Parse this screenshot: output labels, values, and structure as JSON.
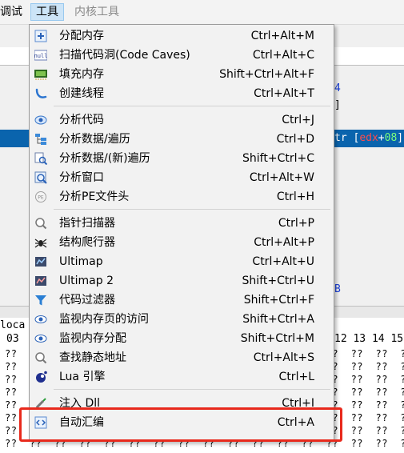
{
  "menubar": {
    "debug_label": "调试",
    "tools_label": "工具",
    "kernel_label": "内核工具"
  },
  "background": {
    "disasm_frag_top": "4",
    "disasm_frag_bracket": "]",
    "sel_text_prefix": "tr [",
    "sel_text_reg": "edx",
    "sel_text_plus": "+",
    "sel_text_offset": "08",
    "sel_text_close": "]",
    "disasm_frag_bottom": "B",
    "hex_header_prefix": "loca",
    "hex_header_left": "03",
    "hex_header_right": "12 13 14 15",
    "hex_cell": "??",
    "hex_rows": [
      "??  ??  ??  ??  ??  ??  ??  ??  ??  ??  ??  ??  ??  ??  ??  ??  ??  ??  ??  ??",
      "??  ??  ??  ??  ??  ??  ??  ??  ??  ??  ??  ??  ??  ??  ??  ??  ??  ??  ??  ??",
      "??  ??  ??  ??  ??  ??  ??  ??  ??  ??  ??  ??  ??  ??  ??  ??  ??  ??  ??  ??",
      "??  ??  ??  ??  ??  ??  ??  ??  ??  ??  ??  ??  ??  ??  ??  ??  ??  ??  ??  ??",
      "??  ??  ??  ??  ??  ??  ??  ??  ??  ??  ??  ??  ??  ??  ??  ??  ??  ??  ??  ??",
      "??  ??  ??  ??  ??  ??  ??  ??  ??  ??  ??  ??  ??  ??  ??  ??  ??  ??  ??  ??",
      "??  ??  ??  ??  ??  ??  ??  ??  ??  ??  ??  ??  ??  ??  ??  ??  ??  ??  ??  ??",
      "??  ??  ??  ??  ??  ??  ??  ??  ??  ??  ??  ??  ??  ??  ??  ??  ??  ??  ??  ??",
      "??  ??  ??  ??  ??  ??  ??  ??  ??  ??  ??  ??  ??  ??  ??  ??  ??  ??  ??  ??"
    ]
  },
  "menu": {
    "items": [
      {
        "label": "分配内存",
        "shortcut": "Ctrl+Alt+M",
        "icon": "plus-icon"
      },
      {
        "label": "扫描代码洞(Code Caves)",
        "shortcut": "Ctrl+Alt+C",
        "icon": "null-icon"
      },
      {
        "label": "填充内存",
        "shortcut": "Shift+Ctrl+Alt+F",
        "icon": "chip-icon"
      },
      {
        "label": "创建线程",
        "shortcut": "Ctrl+Alt+T",
        "icon": "thread-icon"
      },
      {
        "label": "分析代码",
        "shortcut": "Ctrl+J",
        "icon": "eye-code-icon"
      },
      {
        "label": "分析数据/遍历",
        "shortcut": "Ctrl+D",
        "icon": "tree-icon"
      },
      {
        "label": "分析数据/(新)遍历",
        "shortcut": "Shift+Ctrl+C",
        "icon": "tree-new-icon"
      },
      {
        "label": "分析窗口",
        "shortcut": "Ctrl+Alt+W",
        "icon": "window-search-icon"
      },
      {
        "label": "分析PE文件头",
        "shortcut": "Ctrl+H",
        "icon": "pe-header-icon"
      },
      {
        "label": "指针扫描器",
        "shortcut": "Ctrl+P",
        "icon": "magnifier-icon"
      },
      {
        "label": "结构爬行器",
        "shortcut": "Ctrl+Alt+P",
        "icon": "spider-icon"
      },
      {
        "label": "Ultimap",
        "shortcut": "Ctrl+Alt+U",
        "icon": "ultimap-icon"
      },
      {
        "label": "Ultimap 2",
        "shortcut": "Shift+Ctrl+U",
        "icon": "ultimap2-icon"
      },
      {
        "label": "代码过滤器",
        "shortcut": "Shift+Ctrl+F",
        "icon": "filter-icon"
      },
      {
        "label": "监视内存页的访问",
        "shortcut": "Shift+Ctrl+A",
        "icon": "eye-icon"
      },
      {
        "label": "监视内存分配",
        "shortcut": "Shift+Ctrl+M",
        "icon": "eye-alloc-icon"
      },
      {
        "label": "查找静态地址",
        "shortcut": "Ctrl+Alt+S",
        "icon": "static-search-icon"
      },
      {
        "label": "Lua 引擎",
        "shortcut": "Ctrl+L",
        "icon": "lua-icon"
      },
      {
        "label": "注入 Dll",
        "shortcut": "Ctrl+I",
        "icon": "syringe-icon"
      },
      {
        "label": "自动汇编",
        "shortcut": "Ctrl+A",
        "icon": "code-brackets-icon"
      }
    ]
  },
  "colors": {
    "highlight_border": "#e8291c",
    "selection": "#0a64ad",
    "menu_bg": "#f2f2f2"
  }
}
